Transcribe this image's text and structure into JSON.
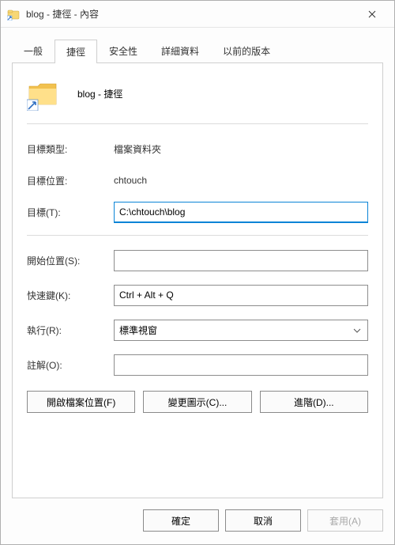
{
  "title": "blog - 捷徑 - 內容",
  "tabs": {
    "general": "一般",
    "shortcut": "捷徑",
    "security": "安全性",
    "details": "詳細資料",
    "previous": "以前的版本"
  },
  "header": {
    "name": "blog - 捷徑"
  },
  "labels": {
    "target_type": "目標類型:",
    "target_location": "目標位置:",
    "target": "目標(T):",
    "start_in": "開始位置(S):",
    "shortcut_key": "快速鍵(K):",
    "run": "執行(R):",
    "comment": "註解(O):"
  },
  "values": {
    "target_type": "檔案資料夾",
    "target_location": "chtouch",
    "target": "C:\\chtouch\\blog",
    "start_in": "",
    "shortcut_key": "Ctrl + Alt + Q",
    "run": "標準視窗",
    "comment": ""
  },
  "buttons": {
    "open_location": "開啟檔案位置(F)",
    "change_icon": "變更圖示(C)...",
    "advanced": "進階(D)...",
    "ok": "確定",
    "cancel": "取消",
    "apply": "套用(A)"
  }
}
